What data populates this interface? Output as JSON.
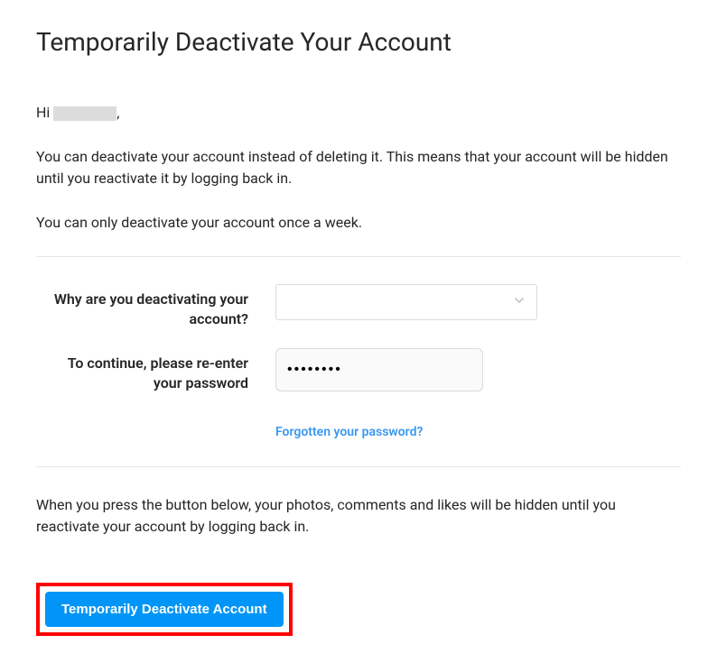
{
  "header": {
    "title": "Temporarily Deactivate Your Account"
  },
  "greeting": {
    "prefix": "Hi ",
    "suffix": ","
  },
  "intro": {
    "p1": "You can deactivate your account instead of deleting it. This means that your account will be hidden until you reactivate it by logging back in.",
    "p2": "You can only deactivate your account once a week."
  },
  "form": {
    "reason_label": "Why are you deactivating your account?",
    "reason_value": "",
    "password_label": "To continue, please re-enter your password",
    "password_value": "••••••••",
    "forgot_link": "Forgotten your password?"
  },
  "footer": {
    "note": "When you press the button below, your photos, comments and likes will be hidden until you reactivate your account by logging back in.",
    "button": "Temporarily Deactivate Account"
  }
}
